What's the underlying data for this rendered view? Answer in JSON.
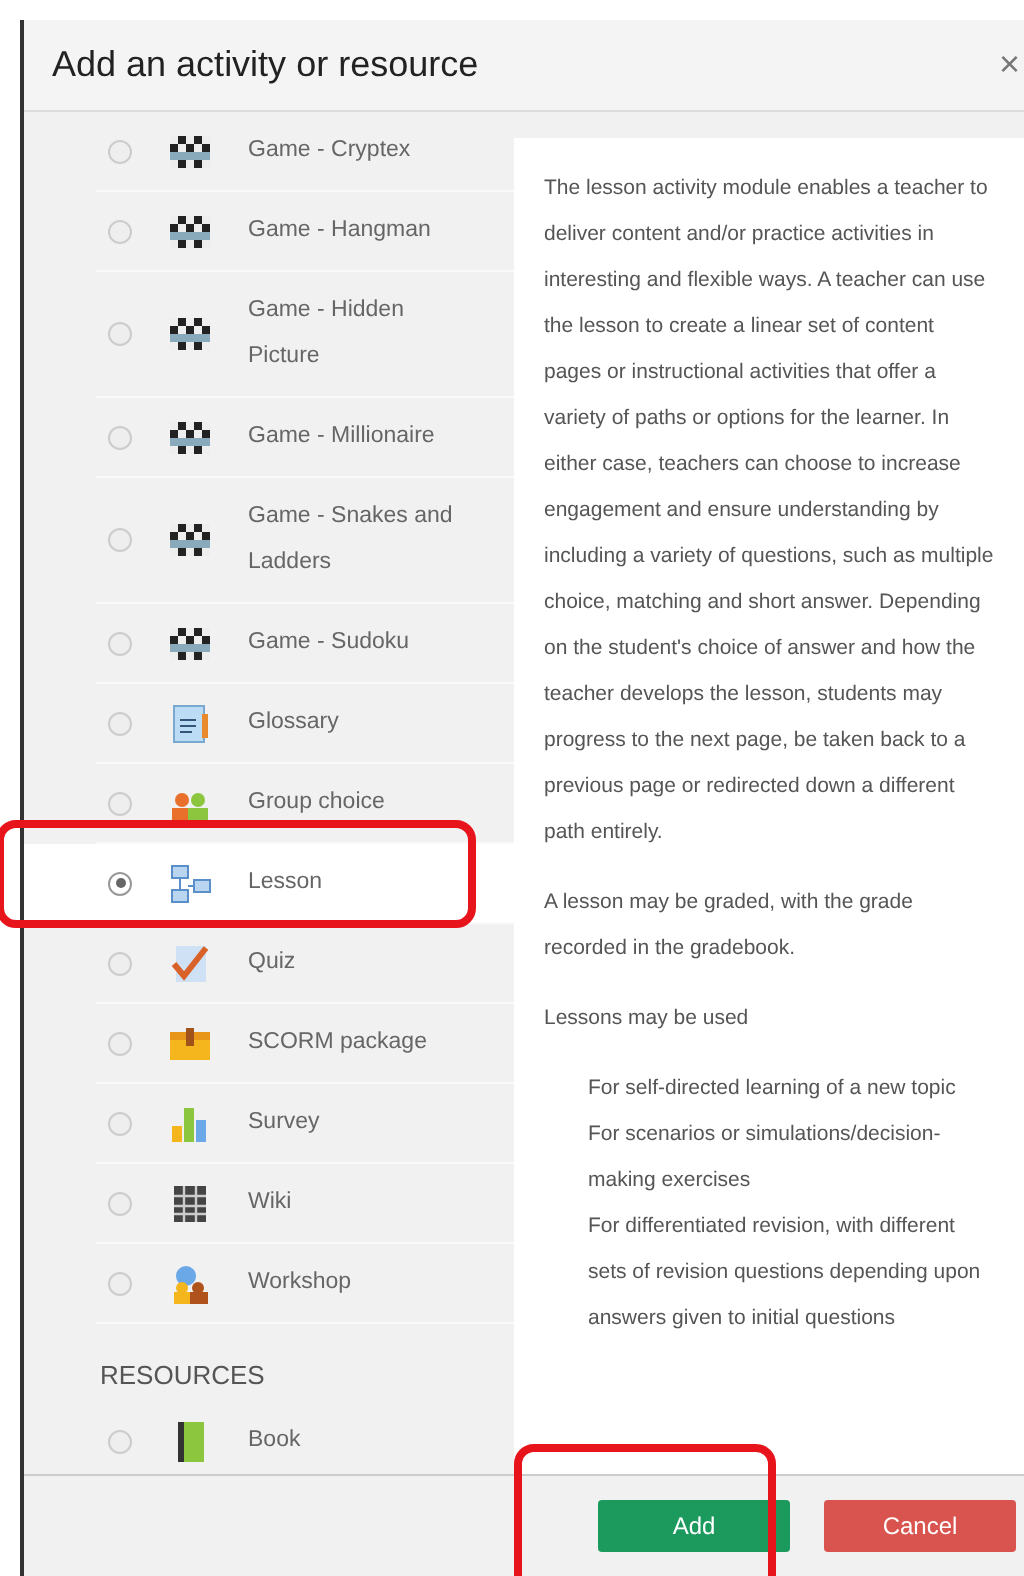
{
  "dialog": {
    "title": "Add an activity or resource",
    "close": "×"
  },
  "activities": [
    {
      "label": "Game - Cryptex",
      "kind": "game",
      "selected": false
    },
    {
      "label": "Game - Hangman",
      "kind": "game",
      "selected": false
    },
    {
      "label": "Game - Hidden Picture",
      "kind": "game",
      "selected": false
    },
    {
      "label": "Game - Millionaire",
      "kind": "game",
      "selected": false
    },
    {
      "label": "Game - Snakes and Ladders",
      "kind": "game",
      "selected": false
    },
    {
      "label": "Game - Sudoku",
      "kind": "game",
      "selected": false
    },
    {
      "label": "Glossary",
      "kind": "glossary",
      "selected": false
    },
    {
      "label": "Group choice",
      "kind": "choice",
      "selected": false
    },
    {
      "label": "Lesson",
      "kind": "lesson",
      "selected": true
    },
    {
      "label": "Quiz",
      "kind": "quiz",
      "selected": false
    },
    {
      "label": "SCORM package",
      "kind": "scorm",
      "selected": false
    },
    {
      "label": "Survey",
      "kind": "survey",
      "selected": false
    },
    {
      "label": "Wiki",
      "kind": "wiki",
      "selected": false
    },
    {
      "label": "Workshop",
      "kind": "workshop",
      "selected": false
    }
  ],
  "resources": {
    "heading": "RESOURCES",
    "items": [
      {
        "label": "Book",
        "kind": "book",
        "selected": false
      }
    ]
  },
  "description": {
    "paragraphs": [
      "The lesson activity module enables a teacher to deliver content and/or practice activities in interesting and flexible ways. A teacher can use the lesson to create a linear set of content pages or instructional activities that offer a variety of paths or options for the learner. In either case, teachers can choose to increase engagement and ensure understanding by including a variety of questions, such as multiple choice, matching and short answer. Depending on the student's choice of answer and how the teacher develops the lesson, students may progress to the next page, be taken back to a previous page or redirected down a different path entirely.",
      "A lesson may be graded, with the grade recorded in the gradebook.",
      "Lessons may be used"
    ],
    "uses": [
      "For self-directed learning of a new topic",
      "For scenarios or simulations/decision-making exercises",
      "For differentiated revision, with different sets of revision questions depending upon answers given to initial questions"
    ]
  },
  "buttons": [
    {
      "label": "Add",
      "kind": "primary"
    },
    {
      "label": "Cancel",
      "kind": "danger"
    }
  ]
}
